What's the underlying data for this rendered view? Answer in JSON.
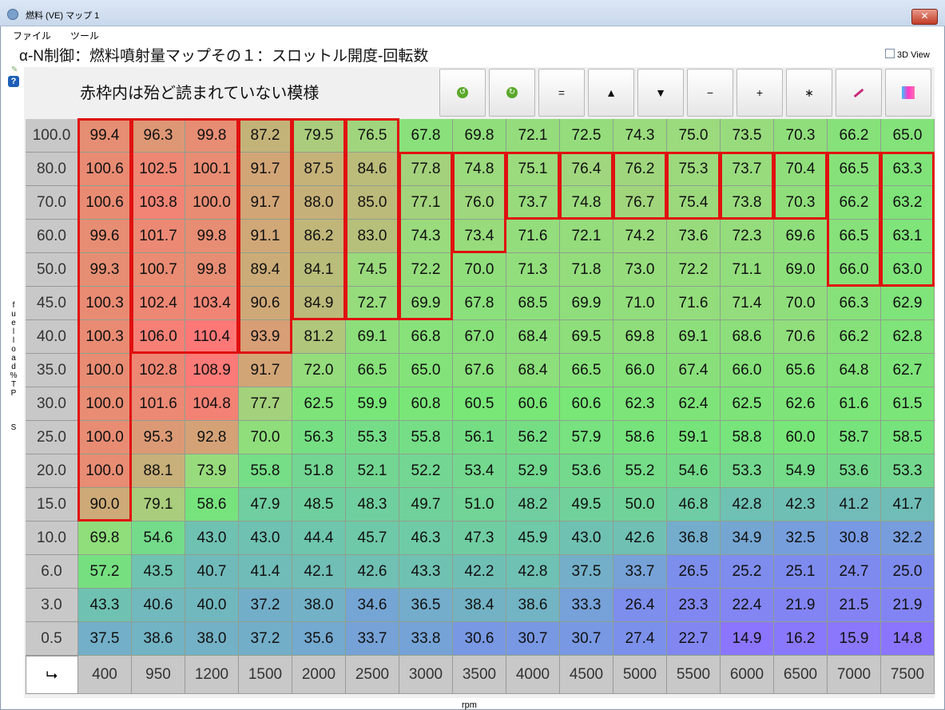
{
  "window": {
    "title": "燃料 (VE) マップ 1",
    "close_glyph": "✕"
  },
  "menu": {
    "items": [
      "ファイル",
      "ツール"
    ]
  },
  "header": {
    "map_title": "α-N制御：燃料噴射量マップその１：スロットル開度-回転数",
    "view3d_label": "3D View",
    "view3d_checked": false
  },
  "annotation": "赤枠内は殆ど読まれていない模様",
  "side": {
    "axis_label": "fuel load % TPS",
    "help_glyph": "?"
  },
  "toolbar": [
    {
      "name": "undo-button",
      "glyph": "↺",
      "icon": "undo-icon"
    },
    {
      "name": "redo-button",
      "glyph": "↻",
      "icon": "redo-icon"
    },
    {
      "name": "set-equal-button",
      "glyph": "=",
      "icon": "equals-icon"
    },
    {
      "name": "increase-button",
      "glyph": "▲",
      "icon": "up-arrow-icon"
    },
    {
      "name": "decrease-button",
      "glyph": "▼",
      "icon": "down-arrow-icon"
    },
    {
      "name": "subtract-button",
      "glyph": "−",
      "icon": "minus-icon"
    },
    {
      "name": "add-button",
      "glyph": "+",
      "icon": "plus-icon"
    },
    {
      "name": "multiply-button",
      "glyph": "∗",
      "icon": "asterisk-icon"
    },
    {
      "name": "pen-button",
      "glyph": "",
      "icon": "pen-icon"
    },
    {
      "name": "color-scale-button",
      "glyph": "",
      "icon": "color-gradient-icon"
    }
  ],
  "rpm_axis_label": "rpm",
  "corner_glyph": "⮡",
  "chart_data": {
    "type": "heatmap",
    "xlabel": "rpm",
    "ylabel": "fuel load % TPS",
    "x": [
      400,
      950,
      1200,
      1500,
      2000,
      2500,
      3000,
      3500,
      4000,
      4500,
      5000,
      5500,
      6000,
      6500,
      7000,
      7500
    ],
    "y": [
      "100.0",
      "80.0",
      "70.0",
      "60.0",
      "50.0",
      "45.0",
      "40.0",
      "35.0",
      "30.0",
      "25.0",
      "20.0",
      "15.0",
      "10.0",
      "6.0",
      "3.0",
      "0.5"
    ],
    "values": [
      [
        "99.4",
        "96.3",
        "99.8",
        "87.2",
        "79.5",
        "76.5",
        "67.8",
        "69.8",
        "72.1",
        "72.5",
        "74.3",
        "75.0",
        "73.5",
        "70.3",
        "66.2",
        "65.0"
      ],
      [
        "100.6",
        "102.5",
        "100.1",
        "91.7",
        "87.5",
        "84.6",
        "77.8",
        "74.8",
        "75.1",
        "76.4",
        "76.2",
        "75.3",
        "73.7",
        "70.4",
        "66.5",
        "63.3"
      ],
      [
        "100.6",
        "103.8",
        "100.0",
        "91.7",
        "88.0",
        "85.0",
        "77.1",
        "76.0",
        "73.7",
        "74.8",
        "76.7",
        "75.4",
        "73.8",
        "70.3",
        "66.2",
        "63.2"
      ],
      [
        "99.6",
        "101.7",
        "99.8",
        "91.1",
        "86.2",
        "83.0",
        "74.3",
        "73.4",
        "71.6",
        "72.1",
        "74.2",
        "73.6",
        "72.3",
        "69.6",
        "66.5",
        "63.1"
      ],
      [
        "99.3",
        "100.7",
        "99.8",
        "89.4",
        "84.1",
        "74.5",
        "72.2",
        "70.0",
        "71.3",
        "71.8",
        "73.0",
        "72.2",
        "71.1",
        "69.0",
        "66.0",
        "63.0"
      ],
      [
        "100.3",
        "102.4",
        "103.4",
        "90.6",
        "84.9",
        "72.7",
        "69.9",
        "67.8",
        "68.5",
        "69.9",
        "71.0",
        "71.6",
        "71.4",
        "70.0",
        "66.3",
        "62.9"
      ],
      [
        "100.3",
        "106.0",
        "110.4",
        "93.9",
        "81.2",
        "69.1",
        "66.8",
        "67.0",
        "68.4",
        "69.5",
        "69.8",
        "69.1",
        "68.6",
        "70.6",
        "66.2",
        "62.8"
      ],
      [
        "100.0",
        "102.8",
        "108.9",
        "91.7",
        "72.0",
        "66.5",
        "65.0",
        "67.6",
        "68.4",
        "66.5",
        "66.0",
        "67.4",
        "66.0",
        "65.6",
        "64.8",
        "62.7"
      ],
      [
        "100.0",
        "101.6",
        "104.8",
        "77.7",
        "62.5",
        "59.9",
        "60.8",
        "60.5",
        "60.6",
        "60.6",
        "62.3",
        "62.4",
        "62.5",
        "62.6",
        "61.6",
        "61.5"
      ],
      [
        "100.0",
        "95.3",
        "92.8",
        "70.0",
        "56.3",
        "55.3",
        "55.8",
        "56.1",
        "56.2",
        "57.9",
        "58.6",
        "59.1",
        "58.8",
        "60.0",
        "58.7",
        "58.5"
      ],
      [
        "100.0",
        "88.1",
        "73.9",
        "55.8",
        "51.8",
        "52.1",
        "52.2",
        "53.4",
        "52.9",
        "53.6",
        "55.2",
        "54.6",
        "53.3",
        "54.9",
        "53.6",
        "53.3"
      ],
      [
        "90.0",
        "79.1",
        "58.6",
        "47.9",
        "48.5",
        "48.3",
        "49.7",
        "51.0",
        "48.2",
        "49.5",
        "50.0",
        "46.8",
        "42.8",
        "42.3",
        "41.2",
        "41.7"
      ],
      [
        "69.8",
        "54.6",
        "43.0",
        "43.0",
        "44.4",
        "45.7",
        "46.3",
        "47.3",
        "45.9",
        "43.0",
        "42.6",
        "36.8",
        "34.9",
        "32.5",
        "30.8",
        "32.2"
      ],
      [
        "57.2",
        "43.5",
        "40.7",
        "41.4",
        "42.1",
        "42.6",
        "43.3",
        "42.2",
        "42.8",
        "37.5",
        "33.7",
        "26.5",
        "25.2",
        "25.1",
        "24.7",
        "25.0"
      ],
      [
        "43.3",
        "40.6",
        "40.0",
        "37.2",
        "38.0",
        "34.6",
        "36.5",
        "38.4",
        "38.6",
        "33.3",
        "26.4",
        "23.3",
        "22.4",
        "21.9",
        "21.5",
        "21.9"
      ],
      [
        "37.5",
        "38.6",
        "38.0",
        "37.2",
        "35.6",
        "33.7",
        "33.8",
        "30.6",
        "30.7",
        "30.7",
        "27.4",
        "22.7",
        "14.9",
        "16.2",
        "15.9",
        "14.8"
      ]
    ],
    "highlight_boxes": [
      {
        "cols": [
          0,
          0
        ],
        "rows": [
          0,
          11
        ]
      },
      {
        "cols": [
          1,
          2
        ],
        "rows": [
          0,
          6
        ]
      },
      {
        "cols": [
          3,
          3
        ],
        "rows": [
          0,
          6
        ]
      },
      {
        "cols": [
          4,
          4
        ],
        "rows": [
          0,
          5
        ]
      },
      {
        "cols": [
          5,
          5
        ],
        "rows": [
          0,
          5
        ]
      },
      {
        "cols": [
          6,
          6
        ],
        "rows": [
          1,
          5
        ]
      },
      {
        "cols": [
          7,
          7
        ],
        "rows": [
          1,
          3
        ]
      },
      {
        "cols": [
          8,
          8
        ],
        "rows": [
          1,
          2
        ]
      },
      {
        "cols": [
          9,
          9
        ],
        "rows": [
          1,
          2
        ]
      },
      {
        "cols": [
          10,
          10
        ],
        "rows": [
          1,
          2
        ]
      },
      {
        "cols": [
          11,
          11
        ],
        "rows": [
          1,
          2
        ]
      },
      {
        "cols": [
          12,
          12
        ],
        "rows": [
          1,
          2
        ]
      },
      {
        "cols": [
          13,
          13
        ],
        "rows": [
          1,
          2
        ]
      },
      {
        "cols": [
          14,
          14
        ],
        "rows": [
          1,
          4
        ]
      },
      {
        "cols": [
          15,
          15
        ],
        "rows": [
          1,
          4
        ]
      }
    ]
  }
}
